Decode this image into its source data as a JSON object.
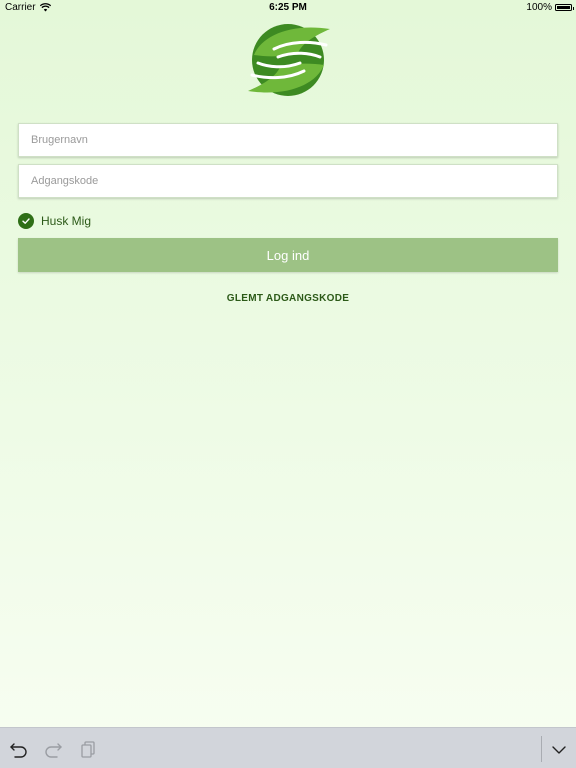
{
  "status_bar": {
    "carrier": "Carrier",
    "time": "6:25 PM",
    "battery": "100%"
  },
  "login_form": {
    "username_placeholder": "Brugernavn",
    "password_placeholder": "Adgangskode",
    "remember_label": "Husk Mig",
    "remember_checked": true,
    "login_label": "Log ind",
    "forgot_label": "GLEMT ADGANGSKODE"
  },
  "keyboard_bar": {
    "icons": [
      "undo-icon",
      "redo-icon",
      "paste-icon",
      "dismiss-keyboard-icon"
    ]
  },
  "colors": {
    "accent_dark_green": "#2f6f17",
    "button_green": "#9dc285",
    "background_light_green": "#e4f8d8"
  }
}
